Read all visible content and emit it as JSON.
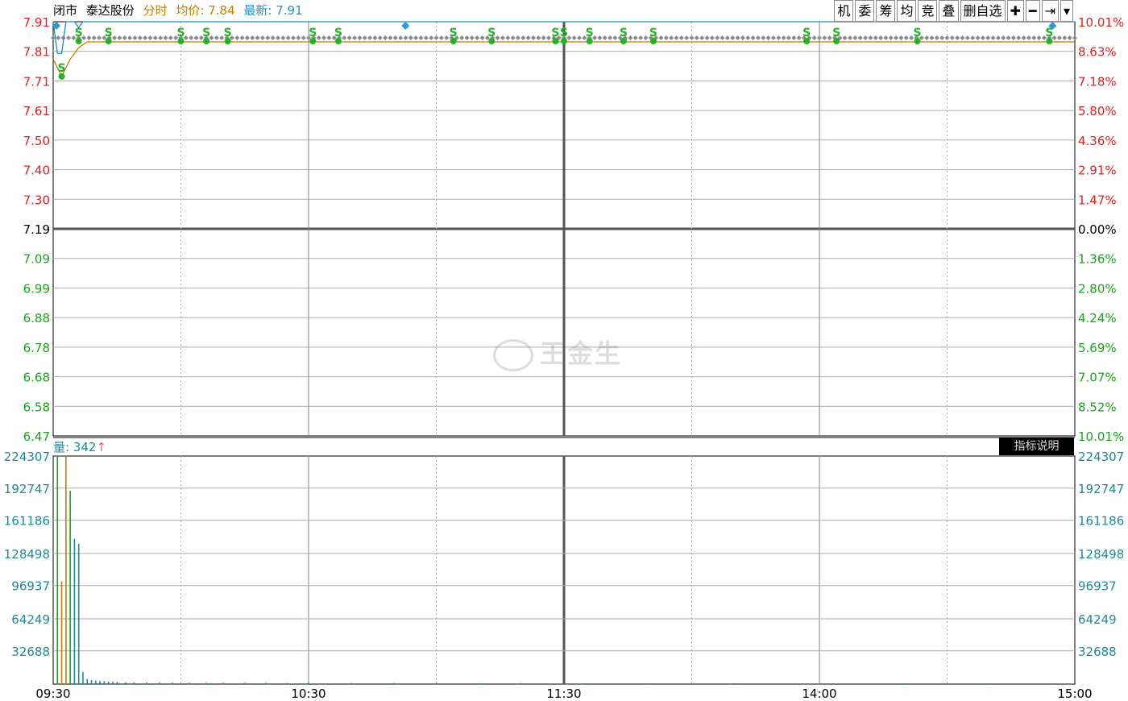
{
  "header": {
    "status": "闭市",
    "stock_name": "泰达股份",
    "mode_label": "分时",
    "avg_label": "均价: 7.84",
    "last_label": "最新: 7.91"
  },
  "toolbar": [
    {
      "label": "机",
      "icon": null
    },
    {
      "label": "委",
      "icon": null
    },
    {
      "label": "筹",
      "icon": null
    },
    {
      "label": "均",
      "icon": null
    },
    {
      "label": "竞",
      "icon": null
    },
    {
      "label": "叠",
      "icon": null
    },
    {
      "label": "删自选",
      "icon": null
    },
    {
      "label": "✚",
      "icon": "plus-icon"
    },
    {
      "label": "━",
      "icon": "minus-icon"
    },
    {
      "label": "⇥",
      "icon": "skip-end-icon"
    },
    {
      "label": "▾",
      "icon": "chevron-down-icon"
    }
  ],
  "volume_header": {
    "label": "量: 342",
    "arrow": "↑"
  },
  "indicator_button": "指标说明",
  "watermark": "王金生",
  "colors": {
    "up": "#e02020",
    "down": "#1aa31a",
    "neutral": "#000000",
    "price_line": "#1e90c8",
    "avg_line": "#c08000",
    "grid": "#999999",
    "vol_teal": "#1a8a9a"
  },
  "chart_data": {
    "type": "line",
    "title": "泰达股份 分时",
    "prev_close": 7.19,
    "price_ticks": [
      "7.91",
      "7.81",
      "7.71",
      "7.61",
      "7.50",
      "7.40",
      "7.30",
      "7.19",
      "7.09",
      "6.99",
      "6.88",
      "6.78",
      "6.68",
      "6.58",
      "6.47"
    ],
    "pct_ticks": [
      "10.01%",
      "8.63%",
      "7.18%",
      "5.80%",
      "4.36%",
      "2.91%",
      "1.47%",
      "0.00%",
      "1.36%",
      "2.80%",
      "4.24%",
      "5.69%",
      "7.07%",
      "8.52%",
      "10.01%"
    ],
    "price_range": [
      6.47,
      7.91
    ],
    "time_ticks": [
      "09:30",
      "10:30",
      "11:30",
      "14:00",
      "15:00"
    ],
    "session_minutes": 240,
    "price_series": {
      "name": "最新",
      "points": [
        [
          0,
          7.91
        ],
        [
          1,
          7.8
        ],
        [
          2,
          7.8
        ],
        [
          3,
          7.91
        ],
        [
          5,
          7.91
        ],
        [
          6,
          7.89
        ],
        [
          7,
          7.91
        ],
        [
          240,
          7.91
        ]
      ]
    },
    "avg_series": {
      "name": "均价",
      "points": [
        [
          0,
          7.78
        ],
        [
          2,
          7.72
        ],
        [
          4,
          7.78
        ],
        [
          6,
          7.82
        ],
        [
          8,
          7.84
        ],
        [
          240,
          7.84
        ]
      ]
    },
    "s_marker_minutes": [
      2,
      6,
      13,
      30,
      36,
      41,
      61,
      67,
      94,
      103,
      118,
      120,
      126,
      134,
      141,
      177,
      184,
      203,
      234
    ],
    "blue_marker_minutes": [
      0,
      82,
      234
    ],
    "volume_ticks": [
      "224307",
      "192747",
      "161186",
      "128498",
      "96937",
      "64249",
      "32688"
    ],
    "volume_max": 224307,
    "volume_bars": [
      {
        "minute": 1,
        "value": 224307,
        "color": "down"
      },
      {
        "minute": 2,
        "value": 101000,
        "color": "avg"
      },
      {
        "minute": 3,
        "value": 224307,
        "color": "avg"
      },
      {
        "minute": 4,
        "value": 190000,
        "color": "down"
      },
      {
        "minute": 5,
        "value": 143000,
        "color": "teal"
      },
      {
        "minute": 6,
        "value": 138000,
        "color": "teal"
      },
      {
        "minute": 7,
        "value": 12000,
        "color": "teal"
      },
      {
        "minute": 8,
        "value": 5000,
        "color": "teal"
      },
      {
        "minute": 9,
        "value": 4000,
        "color": "teal"
      },
      {
        "minute": 10,
        "value": 3500,
        "color": "teal"
      },
      {
        "minute": 11,
        "value": 3000,
        "color": "teal"
      },
      {
        "minute": 12,
        "value": 3000,
        "color": "teal"
      },
      {
        "minute": 13,
        "value": 2500,
        "color": "teal"
      },
      {
        "minute": 14,
        "value": 2200,
        "color": "teal"
      },
      {
        "minute": 15,
        "value": 2000,
        "color": "teal"
      },
      {
        "minute": 17,
        "value": 1800,
        "color": "teal"
      },
      {
        "minute": 19,
        "value": 1600,
        "color": "teal"
      },
      {
        "minute": 22,
        "value": 1500,
        "color": "teal"
      },
      {
        "minute": 25,
        "value": 1500,
        "color": "teal"
      },
      {
        "minute": 28,
        "value": 1400,
        "color": "teal"
      },
      {
        "minute": 32,
        "value": 1400,
        "color": "teal"
      },
      {
        "minute": 36,
        "value": 1300,
        "color": "teal"
      },
      {
        "minute": 40,
        "value": 1300,
        "color": "teal"
      },
      {
        "minute": 45,
        "value": 1200,
        "color": "teal"
      },
      {
        "minute": 50,
        "value": 1200,
        "color": "teal"
      },
      {
        "minute": 55,
        "value": 1100,
        "color": "teal"
      },
      {
        "minute": 60,
        "value": 1100,
        "color": "teal"
      },
      {
        "minute": 70,
        "value": 1000,
        "color": "teal"
      },
      {
        "minute": 80,
        "value": 1000,
        "color": "teal"
      },
      {
        "minute": 90,
        "value": 900,
        "color": "teal"
      },
      {
        "minute": 100,
        "value": 900,
        "color": "teal"
      },
      {
        "minute": 110,
        "value": 900,
        "color": "teal"
      },
      {
        "minute": 125,
        "value": 800,
        "color": "teal"
      },
      {
        "minute": 140,
        "value": 800,
        "color": "teal"
      },
      {
        "minute": 160,
        "value": 800,
        "color": "teal"
      },
      {
        "minute": 180,
        "value": 700,
        "color": "teal"
      },
      {
        "minute": 200,
        "value": 700,
        "color": "teal"
      },
      {
        "minute": 220,
        "value": 700,
        "color": "teal"
      },
      {
        "minute": 235,
        "value": 700,
        "color": "teal"
      }
    ]
  }
}
